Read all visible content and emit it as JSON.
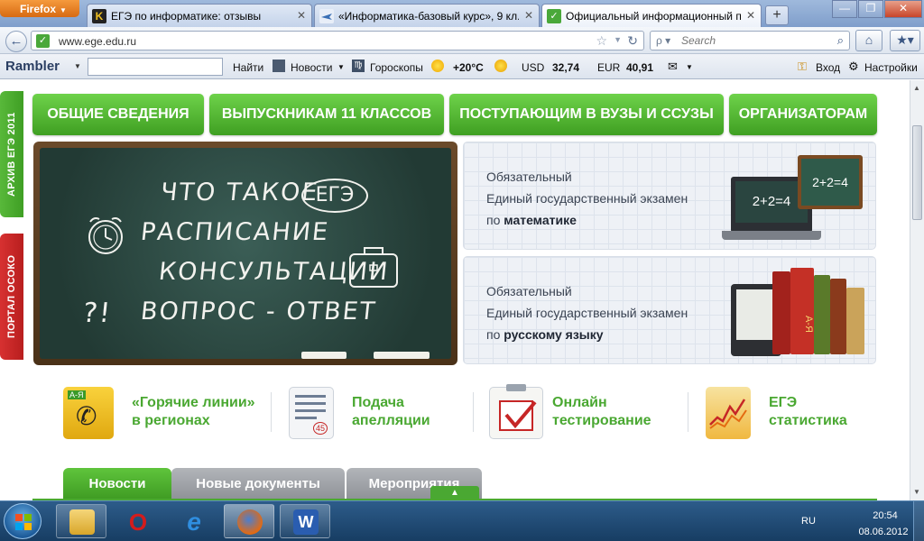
{
  "browser": {
    "menu_label": "Firefox",
    "tabs": [
      {
        "title": "ЕГЭ по информатике: отзывы"
      },
      {
        "title": "«Информатика-базовый курс», 9 кл..."
      },
      {
        "title": "Официальный информационный п..."
      }
    ],
    "new_tab": "+",
    "url": "www.ege.edu.ru",
    "search_placeholder": "Search",
    "search_engine_glyph": "ρ"
  },
  "rambler": {
    "logo": "Rambler",
    "find": "Найти",
    "news": "Новости",
    "horoscopes": "Гороскопы",
    "temperature": "+20°C",
    "usd_label": "USD",
    "usd_value": "32,74",
    "eur_label": "EUR",
    "eur_value": "40,91",
    "login": "Вход",
    "settings": "Настройки"
  },
  "site": {
    "side_archive": "АРХИВ ЕГЭ 2011",
    "side_portal": "ПОРТАЛ ОСОКО",
    "menu": [
      {
        "label": "ОБЩИЕ СВЕДЕНИЯ"
      },
      {
        "label": "ВЫПУСКНИКАМ 11 КЛАССОВ"
      },
      {
        "label": "ПОСТУПАЮЩИМ В ВУЗЫ И ССУЗЫ"
      },
      {
        "label": "ОРГАНИЗАТОРАМ"
      }
    ],
    "board": {
      "line1": "ЧТО ТАКОЕ",
      "ege": "ЕГЭ",
      "line2": "РАСПИСАНИЕ",
      "line3": "КОНСУЛЬТАЦИИ",
      "line4": "ВОПРОС - ОТВЕТ",
      "qmark": "?!"
    },
    "promo_math": {
      "l1": "Обязательный",
      "l2": "Единый государственный экзамен",
      "l3a": "по ",
      "l3b": "математике",
      "laptop_text": "2+2=4",
      "board_text": "2+2=4"
    },
    "promo_rus": {
      "l1": "Обязательный",
      "l2": "Единый государственный экзамен",
      "l3a": "по ",
      "l3b": "русскому языку",
      "book_text": "А-Я"
    },
    "features": [
      {
        "l1": "«Горячие линии»",
        "l2": "в регионах",
        "icon_text": "А-Я"
      },
      {
        "l1": "Подача",
        "l2": "апелляции",
        "icon_text": "45"
      },
      {
        "l1": "Онлайн",
        "l2": "тестирование"
      },
      {
        "l1": "ЕГЭ",
        "l2": "статистика"
      }
    ],
    "news_tabs": [
      {
        "label": "Новости"
      },
      {
        "label": "Новые документы"
      },
      {
        "label": "Мероприятия"
      }
    ]
  },
  "taskbar": {
    "lang": "RU",
    "time": "20:54",
    "date": "08.06.2012",
    "word_glyph": "W",
    "opera_glyph": "O",
    "ie_glyph": "e"
  },
  "colors": {
    "green": "#4aa832",
    "red": "#c62626"
  }
}
